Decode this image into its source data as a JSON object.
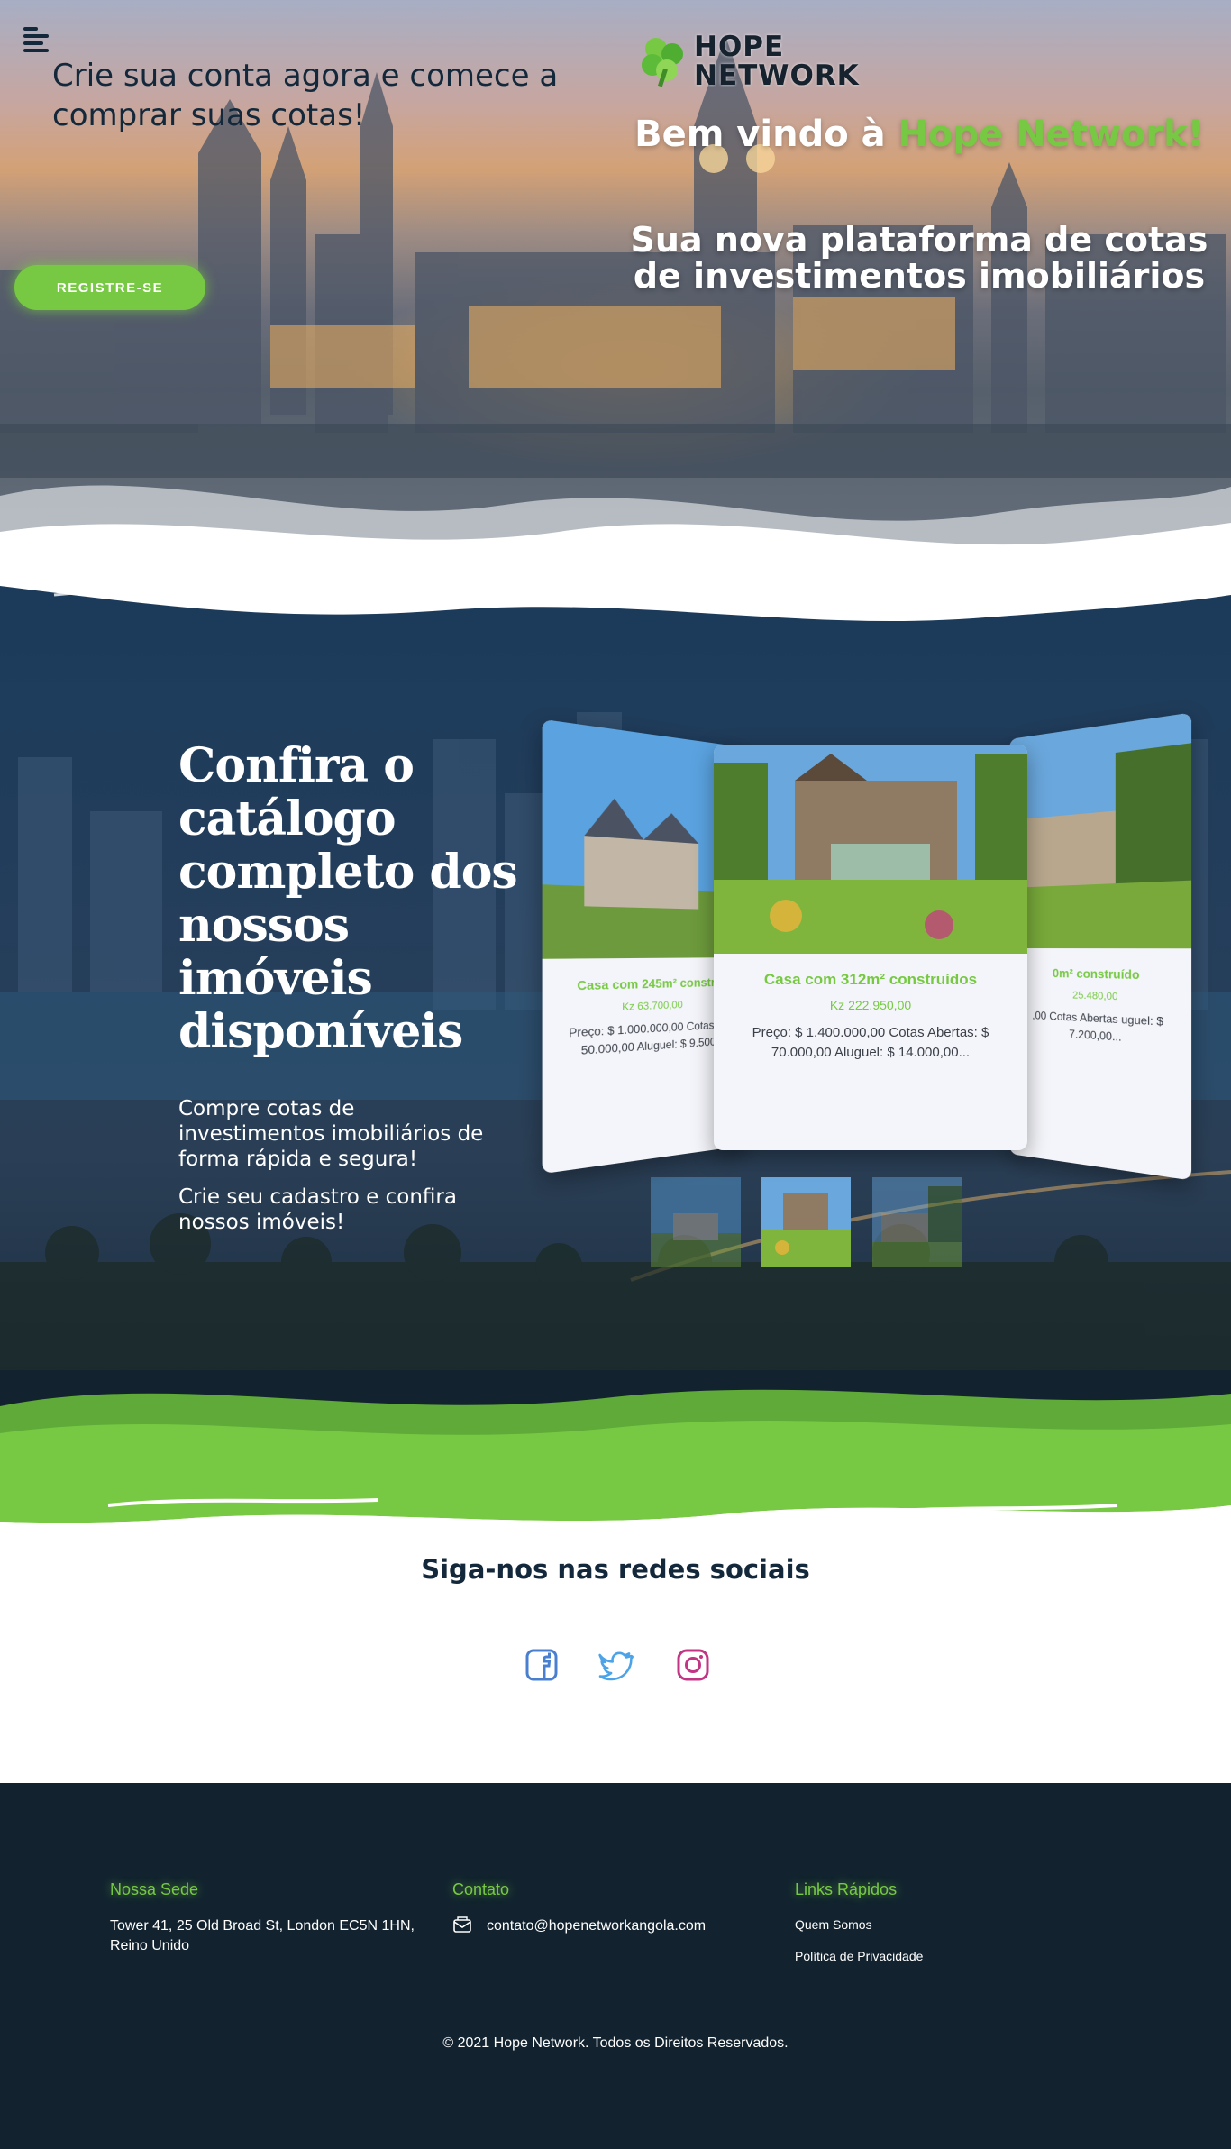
{
  "hero": {
    "cta_title": "Crie sua conta agora e comece a comprar suas cotas!",
    "register_button": "REGISTRE-SE",
    "logo_line1": "HOPE",
    "logo_line2": "NETWORK",
    "welcome_prefix": "Bem vindo à ",
    "welcome_brand": "Hope Network!",
    "subtitle": "Sua nova plataforma de cotas de investimentos imobiliários"
  },
  "catalog": {
    "title": "Confira o catálogo completo dos nossos imóveis disponíveis",
    "text1": "Compre cotas de investimentos imobiliários de forma rápida e segura!",
    "text2": "Crie seu cadastro e confira nossos imóveis!",
    "cards": [
      {
        "title": "Casa com 245m² constru",
        "price": "Kz 63.700,00",
        "desc": "Preço: $ 1.000.000,00 Cotas Ab 50.000,00 Aluguel: $ 9.500,"
      },
      {
        "title": "Casa com 312m² construídos",
        "price": "Kz 222.950,00",
        "desc": "Preço: $ 1.400.000,00 Cotas Abertas: $ 70.000,00 Aluguel: $ 14.000,00..."
      },
      {
        "title": "0m² construído",
        "price": "25.480,00",
        "desc": ",00 Cotas Abertas uguel: $ 7.200,00..."
      }
    ]
  },
  "social": {
    "title": "Siga-nos nas redes sociais",
    "icons": [
      "facebook-icon",
      "twitter-icon",
      "instagram-icon"
    ]
  },
  "footer": {
    "hq_title": "Nossa Sede",
    "hq_address": "Tower 41, 25 Old Broad St, London EC5N 1HN, Reino Unido",
    "contact_title": "Contato",
    "contact_email": "contato@hopenetworkangola.com",
    "links_title": "Links Rápidos",
    "link_about": "Quem Somos",
    "link_privacy": "Política de Privacidade",
    "copyright": "© 2021 Hope Network. Todos os Direitos Reservados."
  },
  "colors": {
    "brand_green": "#77c943",
    "dark_navy": "#12232f",
    "catalog_blue": "#1c3b5b",
    "facebook": "#4a7fd0",
    "twitter": "#4da3e8",
    "instagram": "#c13584"
  }
}
